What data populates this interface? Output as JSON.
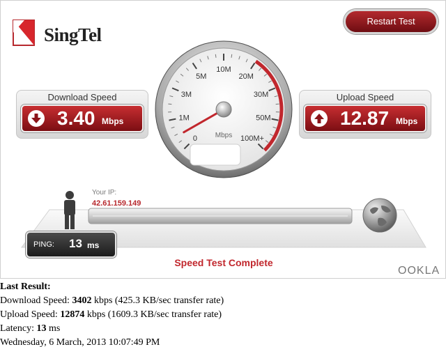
{
  "logo": {
    "text": "SingTel"
  },
  "restart_button": {
    "label": "Restart Test"
  },
  "download": {
    "title": "Download Speed",
    "value": "3.40",
    "unit": "Mbps"
  },
  "upload": {
    "title": "Upload Speed",
    "value": "12.87",
    "unit": "Mbps"
  },
  "gauge": {
    "ticks": [
      {
        "label": "0"
      },
      {
        "label": "1M"
      },
      {
        "label": "3M"
      },
      {
        "label": "5M"
      },
      {
        "label": "10M"
      },
      {
        "label": "20M"
      },
      {
        "label": "30M"
      },
      {
        "label": "50M"
      },
      {
        "label": "100M+"
      }
    ],
    "unit": "Mbps"
  },
  "connection": {
    "ip_label": "Your IP:",
    "ip": "42.61.159.149"
  },
  "ping": {
    "label": "PING:",
    "value": "13",
    "unit": "ms"
  },
  "status": "Speed Test Complete",
  "brand": "OOKLA",
  "colors": {
    "accent": "#b7282d",
    "accent_dark": "#7b0e13"
  },
  "last_result": {
    "heading": "Last Result:",
    "download_prefix": "Download Speed: ",
    "download_value": "3402",
    "download_suffix": " kbps (425.3 KB/sec transfer rate)",
    "upload_prefix": "Upload Speed: ",
    "upload_value": "12874",
    "upload_suffix": " kbps (1609.3 KB/sec transfer rate)",
    "latency_prefix": "Latency: ",
    "latency_value": "13",
    "latency_suffix": " ms",
    "timestamp": "Wednesday, 6 March, 2013 10:07:49 PM"
  }
}
